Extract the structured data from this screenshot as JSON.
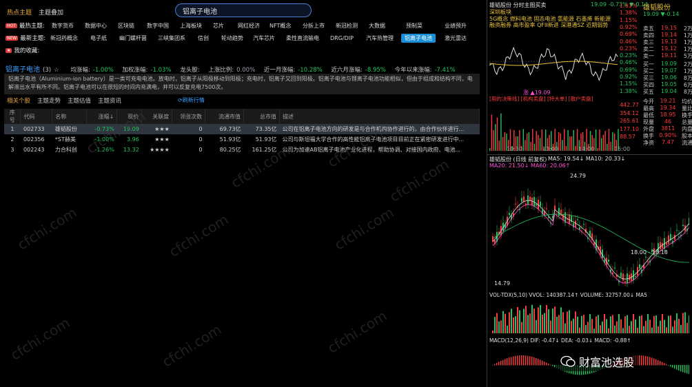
{
  "header": {
    "tab_hot": "热点主题",
    "tab_overlay": "主题叠加",
    "search_value": "铝离子电池"
  },
  "rows": [
    {
      "label": "最热主题:",
      "chips": [
        "数字货币",
        "数据中心",
        "区块链",
        "数字中国",
        "上海板块",
        "芯片",
        "网红经济",
        "NFT概念",
        "分拆上市",
        "新冠检测",
        "大数据",
        "预制菜",
        "业绩预升"
      ]
    },
    {
      "label": "最新主题:",
      "chips": [
        "新冠药概念",
        "电子纸",
        "幽门螺杆菌",
        "三峡集团系",
        "信创",
        "轮动趋势",
        "汽车芯片",
        "柔性直流输电",
        "DRG/DIP",
        "汽车热管理",
        "铝离子电池",
        "激光雷达"
      ]
    },
    {
      "label": "我的收藏:",
      "chips": []
    }
  ],
  "theme": {
    "name": "铝离子电池",
    "count": "(3)",
    "star": "☆",
    "avg_label": "均涨幅:",
    "avg": "-1.00%",
    "wavg_label": "加权涨幅:",
    "wavg": "-1.03%",
    "leader_label": "龙头股:",
    "uprate_label": "上涨比例:",
    "uprate": "0.00%",
    "m1_label": "近一月涨幅:",
    "m1": "-10.28%",
    "m6_label": "近六月涨幅:",
    "m6": "-8.95%",
    "ytd_label": "今年以来涨幅:",
    "ytd": "-7.41%"
  },
  "description": "铝离子电池（Aluminium-ion battery）是一类可充电电池。放电时，铝离子从阳极移动到阳极；充电时，铝离子又回到阳极。铝离子电池与锂离子电池功能相似，但由于组成和结构不同，电解液出水平有所不同。铝离子电池可以在很短的时间内充满电，并可以反复充电7500次。",
  "subtabs": [
    "相关个股",
    "主题走势",
    "主题估值",
    "主题资讯"
  ],
  "refresh": "刷新行情",
  "table": {
    "headers": [
      "序号",
      "代码",
      "名称",
      "涨幅↓",
      "现价",
      "关联度",
      "领涨次数",
      "流通市值",
      "总市值",
      "描述"
    ],
    "rows": [
      [
        "1",
        "002733",
        "雄韬股份",
        "-0.73%",
        "19.09",
        "★★★",
        "0",
        "69.73亿",
        "73.35亿",
        "公司在铝离子电池方向的研发是与合作机构协作进行的，由合作伙伴进行..."
      ],
      [
        "2",
        "002356",
        "*ST赫美",
        "-1.00%",
        "3.96",
        "★★★",
        "0",
        "51.93亿",
        "51.93亿",
        "公司与斯坦福大学合作的高性能铝离子电池项目目前正在紧密研发进行中..."
      ],
      [
        "3",
        "002243",
        "力合科创",
        "-1.26%",
        "13.32",
        "★★★★",
        "0",
        "80.25亿",
        "161.25亿",
        "公司为加速AB铝离子电池产业化进程，帮助协调、对接国内政府、电池..."
      ]
    ]
  },
  "watermark": "cfchi.com",
  "right": {
    "title": "雄韬股份 分时主图买卖",
    "price_line": "19.09 -0.73% ▼-0.14",
    "sector": "深圳板块",
    "concepts": [
      "5G概念 燃料电池 固态电池 氢能源 石墨烯 新能源",
      "融资融券 高市盈率 QFII新进 深港通SZ 近期弱势"
    ],
    "price_axis": [
      "1.61%",
      "1.38%",
      "1.15%",
      "0.92%",
      "0.69%",
      "0.46%",
      "0.23%",
      "0.23%",
      "0.46%",
      "0.69%",
      "0.92%",
      "1.15%",
      "1.38%"
    ],
    "stock_name": "雄韬股份",
    "quote_price": "19.09 ▼-0.14",
    "orderbook_sell": [
      [
        "卖五",
        "19.15",
        "2万"
      ],
      [
        "卖四",
        "19.14",
        "1万"
      ],
      [
        "卖三",
        "19.13",
        "1万"
      ],
      [
        "卖二",
        "19.12",
        "1万"
      ],
      [
        "卖一",
        "19.11",
        "5万"
      ]
    ],
    "orderbook_buy": [
      [
        "买一",
        "19.09",
        "2万"
      ],
      [
        "买二",
        "19.07",
        "1万"
      ],
      [
        "买三",
        "19.06",
        "8万"
      ],
      [
        "买四",
        "19.05",
        "6万"
      ],
      [
        "买五",
        "19.04",
        "8万"
      ]
    ],
    "stats": [
      [
        "今开",
        "19.21",
        "均价"
      ],
      [
        "最高",
        "19.34",
        "量比"
      ],
      [
        "最低",
        "18.95",
        "换手"
      ],
      [
        "现量",
        "46",
        "总量"
      ],
      [
        "外盘",
        "3811",
        "内盘"
      ],
      [
        "换手",
        "0.90%",
        "股本"
      ],
      [
        "净资",
        "7.47",
        "流通"
      ]
    ],
    "vol_axis": [
      "442.77",
      "354.12",
      "265.61",
      "177.10",
      "88.57"
    ],
    "time_labels": [
      "10:30",
      "13:00",
      "14:00",
      "15:00"
    ],
    "limit_text": "涨 ▲19.09",
    "signal_bar": "[用的决策线] [机构卖盘] [特大单] [散户卖盘]",
    "k_title": "雄韬股份 (日线 前复权)",
    "ma_line1": "MA5: 19.54↓  MA10: 20.33↓",
    "ma_line2": "MA20: 21.50↓  MA60: 20.06↑",
    "k_high": "24.79",
    "k_low": "14.79",
    "k_mid": "18.00 - 18.18",
    "vol_title": "VOL-TDX(5,10) VVOL: 140387.14↑  VOLUME: 32757.00↓  MA5",
    "macd_title": "MACD(12,26,9) DIF: -0.47↓  DEA: -0.03↓  MACD: -0.88↑",
    "wechat": "财富池选股",
    "colors": {
      "up": "#ff3b3b",
      "down": "#22c55e",
      "accent": "#e8a83a"
    }
  }
}
